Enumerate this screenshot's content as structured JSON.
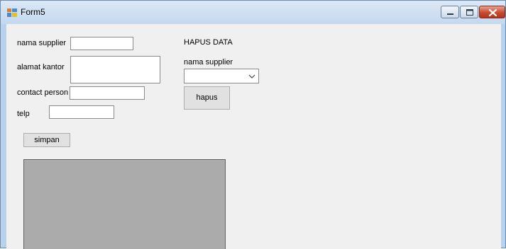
{
  "window": {
    "title": "Form5"
  },
  "form": {
    "nama_supplier_label": "nama supplier",
    "nama_supplier_value": "",
    "alamat_kantor_label": "alamat kantor",
    "alamat_kantor_value": "",
    "contact_person_label": "contact person",
    "contact_person_value": "",
    "telp_label": "telp",
    "telp_value": "",
    "simpan_label": "simpan"
  },
  "hapus_section": {
    "heading": "HAPUS DATA",
    "nama_supplier_label": "nama supplier",
    "nama_supplier_selected": "",
    "hapus_label": "hapus"
  },
  "icons": {
    "app": "form-icon",
    "minimize": "minimize-icon",
    "maximize": "maximize-icon",
    "close": "close-icon",
    "dropdown": "chevron-down-icon"
  },
  "colors": {
    "client_background": "#f0f0f0",
    "grid_background": "#ababab",
    "button_face": "#e1e1e1",
    "close_button": "#c74a2f"
  }
}
